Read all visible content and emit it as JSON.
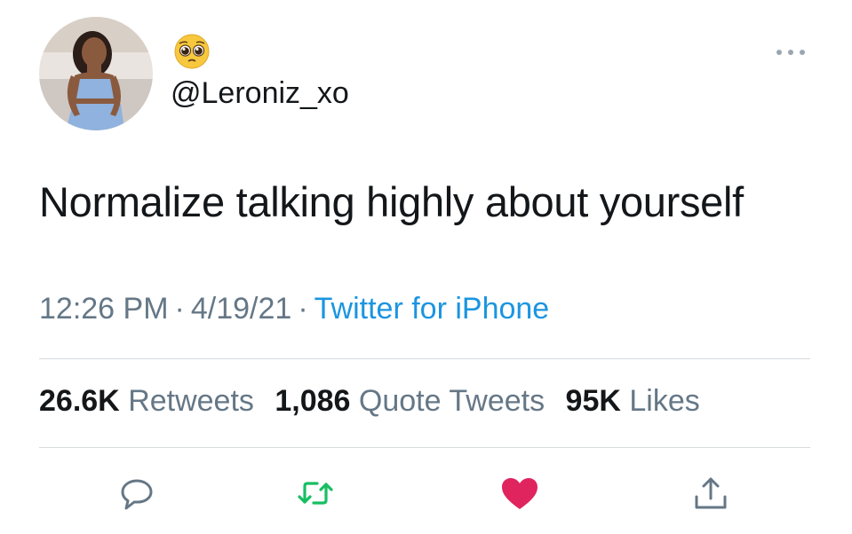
{
  "tweet": {
    "handle": "@Leroniz_xo",
    "name_icon": "pleading-face-emoji",
    "text": "Normalize talking highly about yourself",
    "time": "12:26 PM",
    "date": "4/19/21",
    "separator": "·",
    "source": "Twitter for iPhone"
  },
  "stats": {
    "retweets_count": "26.6K",
    "retweets_label": "Retweets",
    "quote_count": "1,086",
    "quote_label": "Quote Tweets",
    "likes_count": "95K",
    "likes_label": "Likes"
  },
  "actions": {
    "reply_icon": "comment-icon",
    "retweet_icon": "retweet-icon",
    "like_icon": "heart-icon",
    "share_icon": "share-icon"
  },
  "colors": {
    "retweet_green": "#17bf63",
    "like_red": "#e0245e",
    "link_blue": "#1b95e0",
    "secondary_gray": "#657786"
  }
}
